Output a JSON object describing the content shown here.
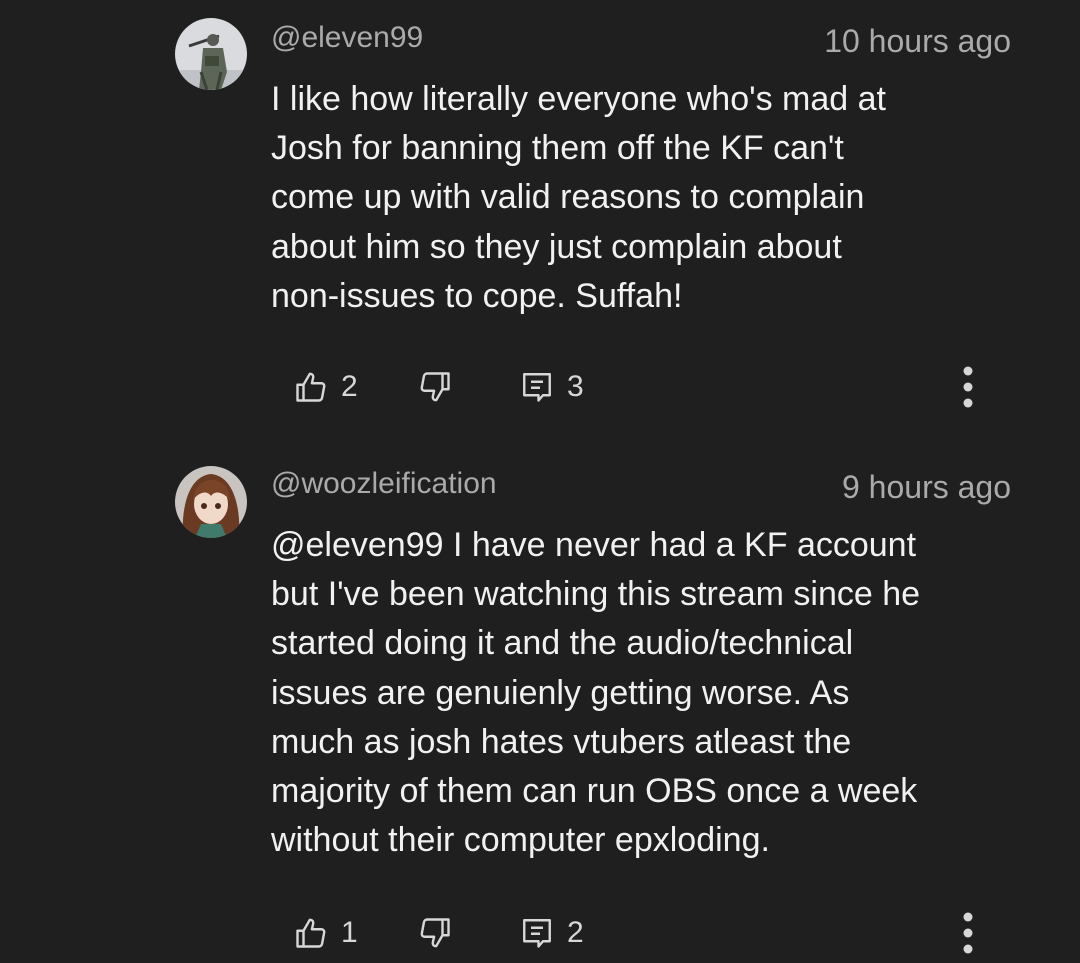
{
  "comments": [
    {
      "handle": "@eleven99",
      "time": "10 hours ago",
      "text": "I like how literally everyone who's mad at\nJosh for banning them off the KF can't\ncome up with valid reasons to complain\nabout him so they just complain about\nnon-issues to cope. Suffah!",
      "likes": "2",
      "replies": "3"
    },
    {
      "handle": "@woozleification",
      "time": "9 hours ago",
      "text": "@eleven99 I have never had a KF account\nbut I've been watching this stream since he\nstarted doing it and the audio/technical\nissues are genuienly getting worse. As\nmuch as josh hates vtubers atleast the\nmajority of them can run OBS once a week\nwithout their computer epxloding.",
      "likes": "1",
      "replies": "2"
    }
  ],
  "icons": {
    "like": "thumbs-up-icon",
    "dislike": "thumbs-down-icon",
    "reply": "reply-icon",
    "more": "more-vert-icon"
  },
  "colors": {
    "background": "#1f1f1f",
    "primary_text": "#f1f1f1",
    "secondary_text": "#aaaaaa",
    "icon": "#d7d7d7"
  }
}
